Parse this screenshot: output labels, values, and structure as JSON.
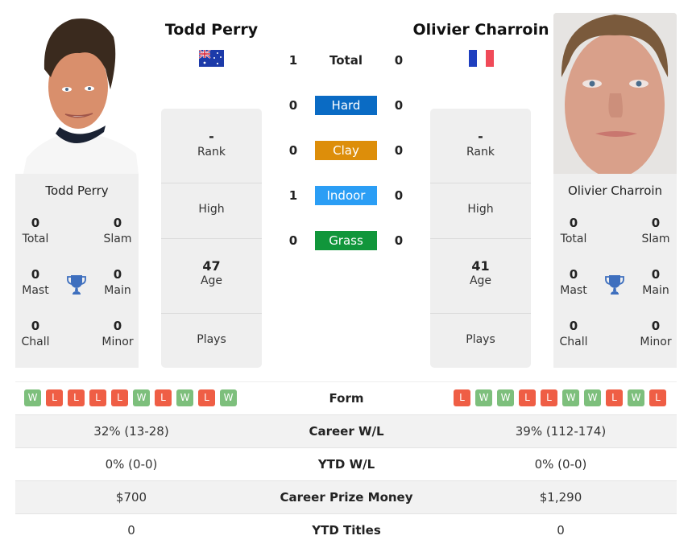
{
  "player1": {
    "name": "Todd Perry",
    "country_flag": "australia-flag",
    "photo": "player-photo",
    "titles": {
      "total": {
        "value": "0",
        "label": "Total"
      },
      "slam": {
        "value": "0",
        "label": "Slam"
      },
      "mast": {
        "value": "0",
        "label": "Mast"
      },
      "main": {
        "value": "0",
        "label": "Main"
      },
      "chall": {
        "value": "0",
        "label": "Chall"
      },
      "minor": {
        "value": "0",
        "label": "Minor"
      }
    },
    "rank": {
      "value": "-",
      "label": "Rank"
    },
    "high": {
      "value": "",
      "label": "High"
    },
    "age": {
      "value": "47",
      "label": "Age"
    },
    "plays": {
      "value": "",
      "label": "Plays"
    },
    "form": [
      "W",
      "L",
      "L",
      "L",
      "L",
      "W",
      "L",
      "W",
      "L",
      "W"
    ],
    "career_wl": "32% (13-28)",
    "ytd_wl": "0% (0-0)",
    "career_prize_money": "$700",
    "ytd_titles": "0"
  },
  "player2": {
    "name": "Olivier Charroin",
    "country_flag": "france-flag",
    "photo": "player-photo",
    "titles": {
      "total": {
        "value": "0",
        "label": "Total"
      },
      "slam": {
        "value": "0",
        "label": "Slam"
      },
      "mast": {
        "value": "0",
        "label": "Mast"
      },
      "main": {
        "value": "0",
        "label": "Main"
      },
      "chall": {
        "value": "0",
        "label": "Chall"
      },
      "minor": {
        "value": "0",
        "label": "Minor"
      }
    },
    "rank": {
      "value": "-",
      "label": "Rank"
    },
    "high": {
      "value": "",
      "label": "High"
    },
    "age": {
      "value": "41",
      "label": "Age"
    },
    "plays": {
      "value": "",
      "label": "Plays"
    },
    "form": [
      "L",
      "W",
      "W",
      "L",
      "L",
      "W",
      "W",
      "L",
      "W",
      "L"
    ],
    "career_wl": "39% (112-174)",
    "ytd_wl": "0% (0-0)",
    "career_prize_money": "$1,290",
    "ytd_titles": "0"
  },
  "h2h": {
    "total": {
      "label": "Total",
      "p1": "1",
      "p2": "0"
    },
    "surfaces": [
      {
        "label": "Hard",
        "p1": "0",
        "p2": "0",
        "color": "#0a6bc4"
      },
      {
        "label": "Clay",
        "p1": "0",
        "p2": "0",
        "color": "#dd8e0a"
      },
      {
        "label": "Indoor",
        "p1": "1",
        "p2": "0",
        "color": "#2b9ef5"
      },
      {
        "label": "Grass",
        "p1": "0",
        "p2": "0",
        "color": "#11963b"
      }
    ]
  },
  "comparison": {
    "form_label": "Form",
    "career_wl_label": "Career W/L",
    "ytd_wl_label": "YTD W/L",
    "career_prize_money_label": "Career Prize Money",
    "ytd_titles_label": "YTD Titles"
  },
  "colors": {
    "win": "#7dbf7c",
    "loss": "#ef5e45",
    "trophy": "#3e6fbe"
  }
}
